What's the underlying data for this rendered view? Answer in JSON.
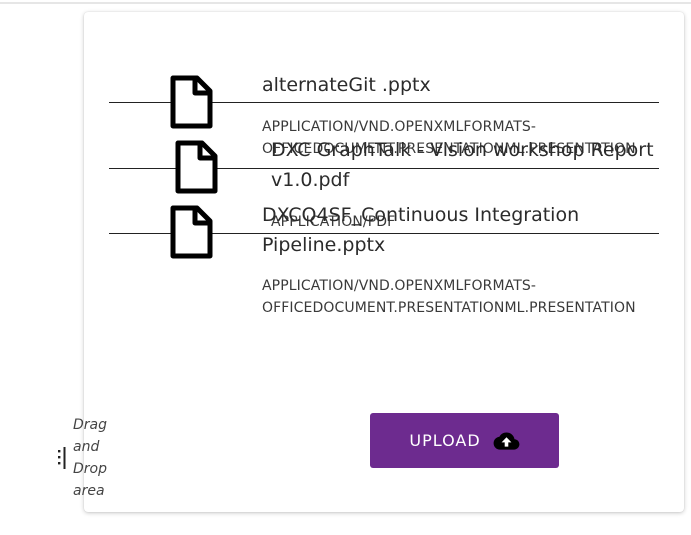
{
  "files": [
    {
      "name": "alternateGit .pptx",
      "type": "APPLICATION/VND.OPENXMLFORMATS-OFFICEDOCUMENT.PRESENTATIONML.PRESENTATION",
      "icon": "file-icon"
    },
    {
      "name": "DXC GraphTalk - Vision workshop Report v1.0.pdf",
      "type": "APPLICATION/PDF",
      "icon": "file-icon"
    },
    {
      "name": "DXCQ4SF_Continuous Integration Pipeline.pptx",
      "type": "APPLICATION/VND.OPENXMLFORMATS-OFFICEDOCUMENT.PRESENTATIONML.PRESENTATION",
      "icon": "file-icon"
    }
  ],
  "upload": {
    "label": "UPLOAD",
    "icon": "cloud-upload-icon"
  },
  "drop_area": {
    "label": "Drag and Drop area",
    "icon": "drag-handle-icon"
  },
  "colors": {
    "accent": "#6d2b8f",
    "text": "#2b2b2b",
    "divider": "#222222"
  }
}
